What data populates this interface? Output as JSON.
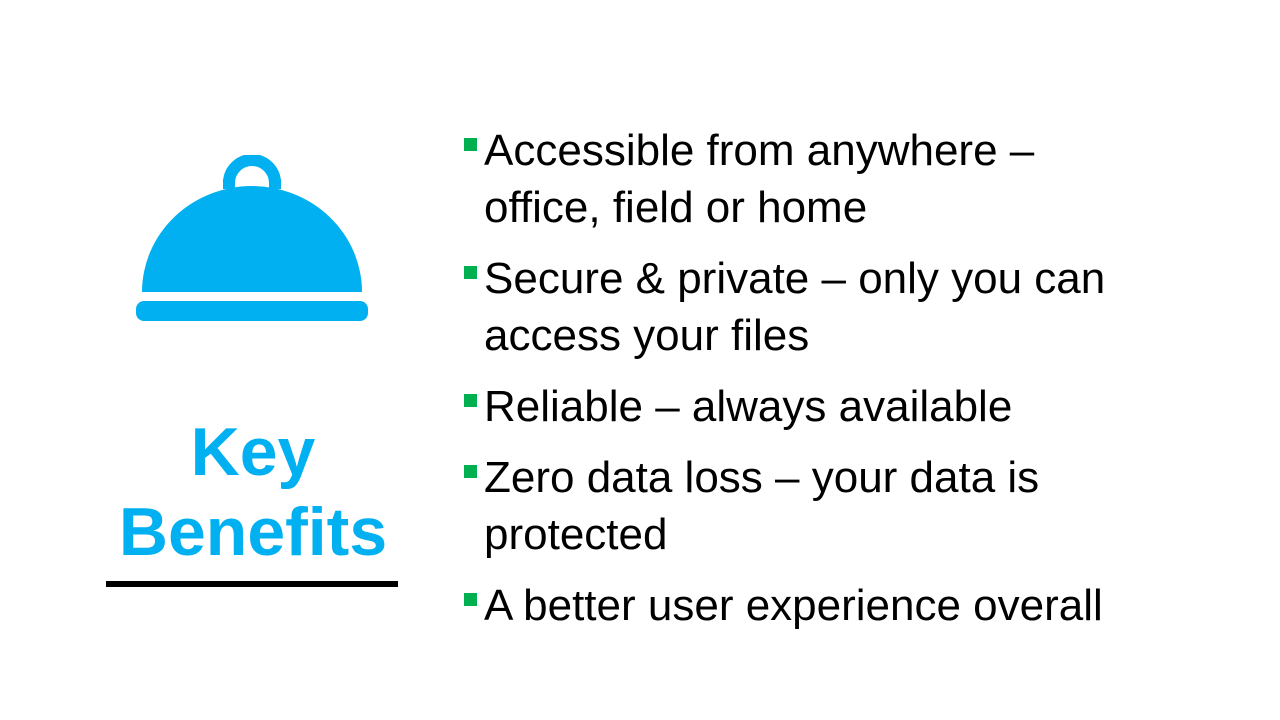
{
  "slide": {
    "icon": "cloche-icon",
    "title_line1": "Key",
    "title_line2": "Benefits",
    "colors": {
      "accent": "#00b0f0",
      "bullet": "#00b050",
      "text": "#000000",
      "underline": "#000000"
    },
    "bullets": [
      {
        "line1": "Accessible from anywhere –",
        "line2": "office, field or home"
      },
      {
        "line1": "Secure & private – only you can",
        "line2": "access your files"
      },
      {
        "line1": "Reliable – always available",
        "line2": ""
      },
      {
        "line1": "Zero data loss – your data is",
        "line2": "protected"
      },
      {
        "line1": "A better user experience overall",
        "line2": ""
      }
    ]
  }
}
